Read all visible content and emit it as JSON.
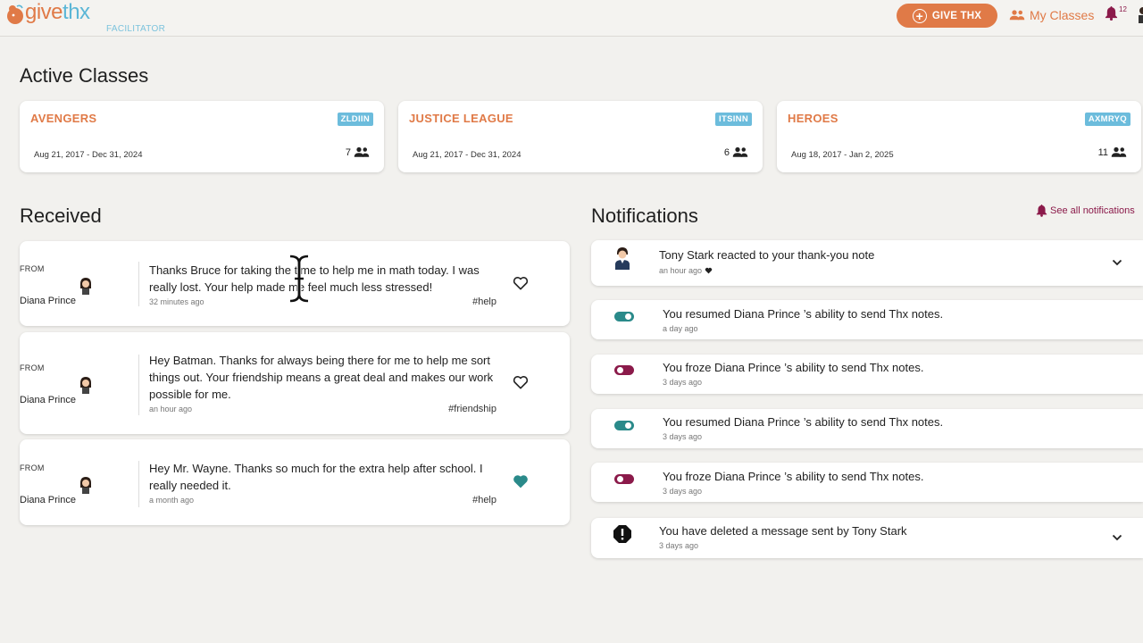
{
  "header": {
    "logo_give": "give",
    "logo_thx": "thx",
    "role": "FACILITATOR",
    "give_button": "GIVE THX",
    "my_classes": "My Classes",
    "notif_count": "12"
  },
  "active_classes": {
    "title": "Active Classes",
    "items": [
      {
        "name": "AVENGERS",
        "code": "ZLDIIN",
        "dates": "Aug 21, 2017 - Dec 31, 2024",
        "count": "7"
      },
      {
        "name": "JUSTICE LEAGUE",
        "code": "ITSINN",
        "dates": "Aug 21, 2017 - Dec 31, 2024",
        "count": "6"
      },
      {
        "name": "HEROES",
        "code": "AXMRYQ",
        "dates": "Aug 18, 2017 - Jan 2, 2025",
        "count": "11"
      }
    ]
  },
  "received": {
    "title": "Received",
    "items": [
      {
        "from_label": "FROM",
        "from_name": "Diana Prince",
        "message": "Thanks Bruce for taking the time to help me in math today. I was really lost. Your help made me feel much less stressed!",
        "time": "32 minutes ago",
        "tag": "#help",
        "liked": false
      },
      {
        "from_label": "FROM",
        "from_name": "Diana Prince",
        "message": "Hey Batman. Thanks for always being there for me to help me sort things out. Your friendship means a great deal and makes our work possible for me.",
        "time": "an hour ago",
        "tag": "#friendship",
        "liked": false
      },
      {
        "from_label": "FROM",
        "from_name": "Diana Prince",
        "message": "Hey Mr. Wayne. Thanks so much for the extra help after school. I really needed it.",
        "time": "a month ago",
        "tag": "#help",
        "liked": true
      }
    ]
  },
  "notifications": {
    "title": "Notifications",
    "see_all": "See all notifications",
    "items": [
      {
        "kind": "reaction",
        "text": "Tony Stark reacted to your thank-you note",
        "time": "an hour ago"
      },
      {
        "kind": "resumed",
        "text": "You resumed Diana Prince ’s ability to send Thx notes.",
        "time": "a day ago"
      },
      {
        "kind": "froze",
        "text": "You froze Diana Prince ’s ability to send Thx notes.",
        "time": "3 days ago"
      },
      {
        "kind": "resumed",
        "text": "You resumed Diana Prince ’s ability to send Thx notes.",
        "time": "3 days ago"
      },
      {
        "kind": "froze",
        "text": "You froze Diana Prince ’s ability to send Thx notes.",
        "time": "3 days ago"
      },
      {
        "kind": "deleted",
        "text": "You have deleted a message sent by Tony Stark",
        "time": "3 days ago"
      }
    ]
  },
  "colors": {
    "accent": "#e07a47",
    "code_badge": "#6cbcdc",
    "toggle_on": "#2a8a8a",
    "toggle_off": "#8b1a4a",
    "heart_filled": "#2a8a8a"
  },
  "icons": [
    "logo-mark-icon",
    "plus-circle-icon",
    "people-icon",
    "bell-icon",
    "heart-outline-icon",
    "heart-filled-icon",
    "toggle-icon",
    "alert-octagon-icon",
    "chevron-down-icon",
    "text-cursor-icon"
  ]
}
